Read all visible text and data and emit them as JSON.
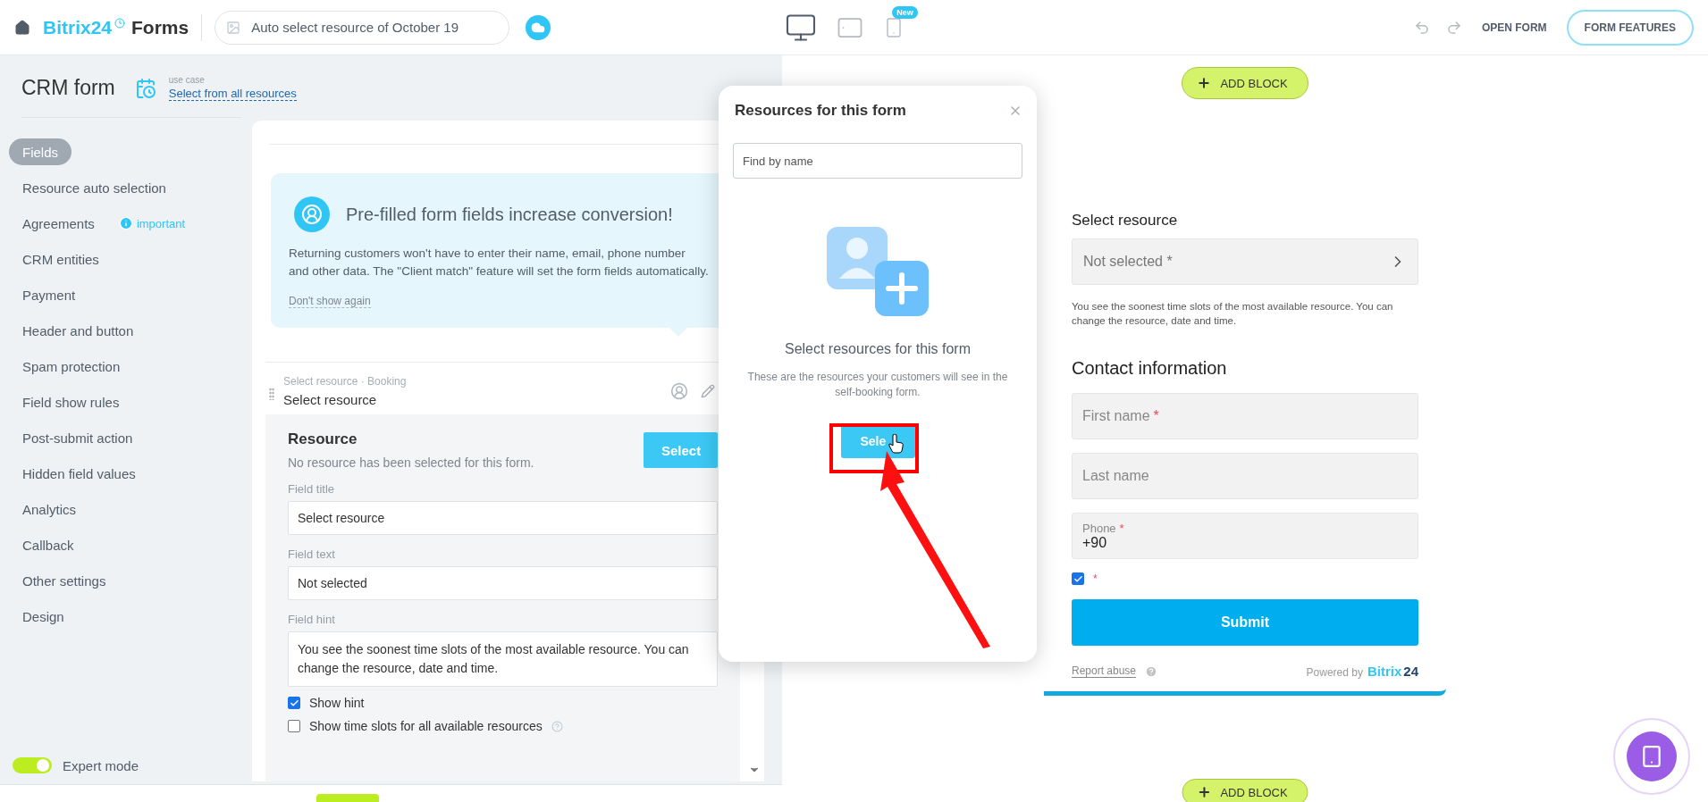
{
  "header": {
    "logo_brand": "Bitrix24",
    "logo_product": "Forms",
    "form_name": "Auto select resource of October 19",
    "devices": [
      {
        "kind": "desktop",
        "selected": true
      },
      {
        "kind": "tablet",
        "selected": false
      },
      {
        "kind": "mobile",
        "selected": false,
        "badge": "New"
      }
    ],
    "open_form": "OPEN FORM",
    "form_features": "FORM FEATURES"
  },
  "sidebar": {
    "title": "CRM form",
    "use_case_label": "use case",
    "use_case_link": "Select from all resources",
    "items": [
      {
        "label": "Fields",
        "selected": true
      },
      {
        "label": "Resource auto selection",
        "selected": false
      },
      {
        "label": "Agreements",
        "selected": false,
        "badge": "important"
      },
      {
        "label": "CRM entities",
        "selected": false
      },
      {
        "label": "Payment",
        "selected": false
      },
      {
        "label": "Header and button",
        "selected": false
      },
      {
        "label": "Spam protection",
        "selected": false
      },
      {
        "label": "Field show rules",
        "selected": false
      },
      {
        "label": "Post-submit action",
        "selected": false
      },
      {
        "label": "Hidden field values",
        "selected": false
      },
      {
        "label": "Analytics",
        "selected": false
      },
      {
        "label": "Callback",
        "selected": false
      },
      {
        "label": "Other settings",
        "selected": false
      },
      {
        "label": "Design",
        "selected": false
      }
    ],
    "expert_mode": {
      "label": "Expert mode",
      "on": true
    }
  },
  "editor": {
    "banner": {
      "title": "Pre-filled form fields increase conversion!",
      "text": "Returning customers won't have to enter their name, email, phone number and other data. The \"Client match\" feature will set the form fields automatically.",
      "dismiss": "Don't show again"
    },
    "field": {
      "path": "Select resource · Booking",
      "name": "Select resource"
    },
    "resource": {
      "title": "Resource",
      "note": "No resource has been selected for this form.",
      "button": "Select"
    },
    "inputs": [
      {
        "label": "Field title",
        "value": "Select resource"
      },
      {
        "label": "Field text",
        "value": "Not selected"
      },
      {
        "label": "Field hint",
        "value": "You see the soonest time slots of the most available resource. You can change the resource, date and time."
      }
    ],
    "options": [
      {
        "label": "Show hint",
        "checked": true
      },
      {
        "label": "Show time slots for all available resources",
        "checked": false
      }
    ]
  },
  "modal": {
    "title": "Resources for this form",
    "search_placeholder": "Find by name",
    "empty_title": "Select resources for this form",
    "empty_text": "These are the resources your customers will see in the self-booking form.",
    "button": "Sele"
  },
  "preview": {
    "add_block": "ADD BLOCK",
    "resource_label": "Select resource",
    "resource_value": "Not selected *",
    "resource_hint": "You see the soonest time slots of the most available resource. You can change the resource, date and time.",
    "section_title": "Contact information",
    "fields": [
      {
        "label": "First name",
        "mark": "*"
      },
      {
        "label": "Last name"
      },
      {
        "label": "Phone",
        "mark": "*",
        "value": "+90"
      }
    ],
    "consent": {
      "checked": true,
      "mark": "*"
    },
    "submit": "Submit",
    "report": "Report abuse",
    "powered_by": "Powered by",
    "brand_a": "Bitrix",
    "brand_b": "24",
    "bottom_add_block": "ADD BLOCK"
  }
}
